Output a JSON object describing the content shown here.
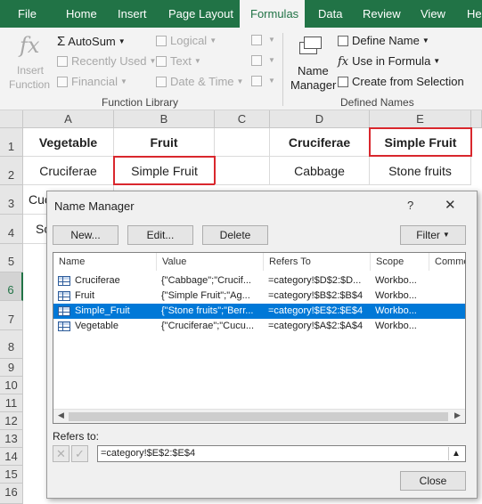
{
  "ribbon_tabs": [
    "File",
    "Home",
    "Insert",
    "Page Layout",
    "Formulas",
    "Data",
    "Review",
    "View",
    "Help"
  ],
  "active_tab": "Formulas",
  "function_library": {
    "insert_function": [
      "Insert",
      "Function"
    ],
    "autosum": "AutoSum",
    "recently_used": "Recently Used",
    "financial": "Financial",
    "logical": "Logical",
    "text": "Text",
    "date_time": "Date & Time",
    "group_label": "Function Library"
  },
  "defined_names": {
    "name_manager": [
      "Name",
      "Manager"
    ],
    "define_name": "Define Name",
    "use_in_formula": "Use in Formula",
    "create_from_selection": "Create from Selection",
    "group_label": "Defined Names"
  },
  "sheet": {
    "columns": [
      "A",
      "B",
      "C",
      "D",
      "E"
    ],
    "rows": [
      "1",
      "2",
      "3",
      "4",
      "5",
      "6",
      "7",
      "8",
      "9",
      "10",
      "11",
      "12",
      "13",
      "14",
      "15",
      "16"
    ],
    "selected_row": "6",
    "cells": {
      "A1": "Vegetable",
      "B1": "Fruit",
      "D1": "Cruciferae",
      "E1": "Simple Fruit",
      "A2": "Cruciferae",
      "B2": "Simple Fruit",
      "D2": "Cabbage",
      "E2": "Stone fruits",
      "A3": "Cuc",
      "A4": "Sc"
    }
  },
  "name_manager": {
    "title": "Name Manager",
    "help": "?",
    "close_x": "✕",
    "buttons": {
      "new": "New...",
      "edit": "Edit...",
      "delete": "Delete",
      "filter": "Filter"
    },
    "columns": [
      "Name",
      "Value",
      "Refers To",
      "Scope",
      "Comme"
    ],
    "rows": [
      {
        "name": "Cruciferae",
        "value": "{\"Cabbage\";\"Crucif...",
        "refers_to": "=category!$D$2:$D...",
        "scope": "Workbo..."
      },
      {
        "name": "Fruit",
        "value": "{\"Simple Fruit\";\"Ag...",
        "refers_to": "=category!$B$2:$B$4",
        "scope": "Workbo..."
      },
      {
        "name": "Simple_Fruit",
        "value": "{\"Stone fruits\";\"Berr...",
        "refers_to": "=category!$E$2:$E$4",
        "scope": "Workbo..."
      },
      {
        "name": "Vegetable",
        "value": "{\"Cruciferae\";\"Cucu...",
        "refers_to": "=category!$A$2:$A$4",
        "scope": "Workbo..."
      }
    ],
    "selected_index": 2,
    "refers_to_label": "Refers to:",
    "refers_to_value": "=category!$E$2:$E$4",
    "close_button": "Close"
  },
  "colors": {
    "excel_green": "#217346",
    "selection_blue": "#0078d7",
    "highlight_red": "#d9272d"
  }
}
